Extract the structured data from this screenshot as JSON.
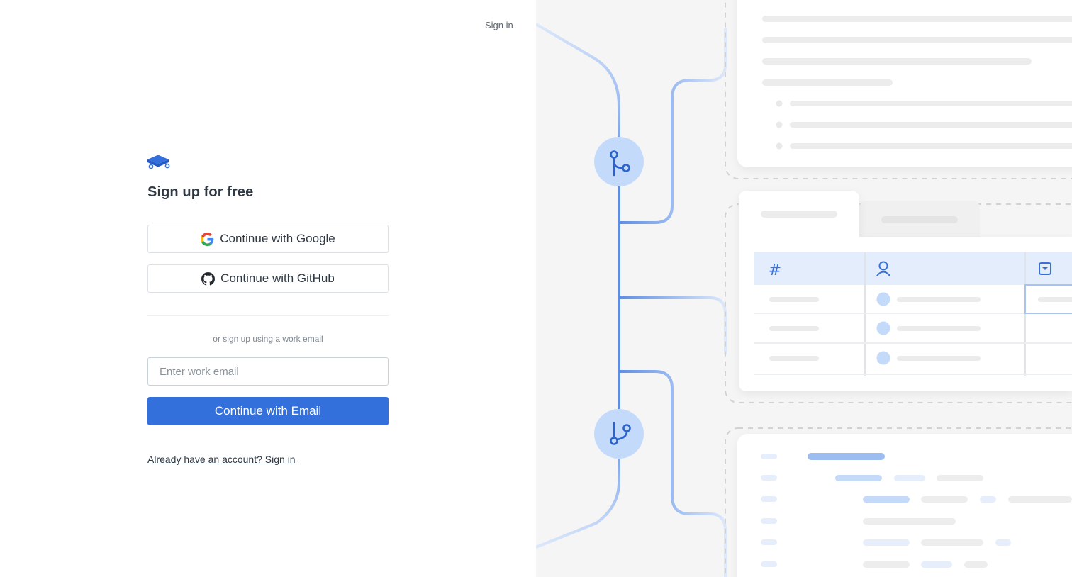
{
  "header": {
    "signin_label": "Sign in"
  },
  "signup": {
    "title": "Sign up for free",
    "google_label": "Continue with Google",
    "github_label": "Continue with GitHub",
    "or_text": "or sign up using a work email",
    "email_placeholder": "Enter work email",
    "email_value": "",
    "email_button_label": "Continue with Email",
    "account_link_label": "Already have an account? Sign in"
  },
  "illustration": {
    "table_header_icons": [
      "hash-icon",
      "person-icon",
      "dropdown-icon"
    ],
    "header_hash_glyph": "#",
    "node_icons": [
      "git-merge-icon",
      "git-branch-icon"
    ]
  },
  "colors": {
    "accent": "#3470dc",
    "node_fill": "#c4dafa",
    "line_blue": "#5c8ee6"
  }
}
